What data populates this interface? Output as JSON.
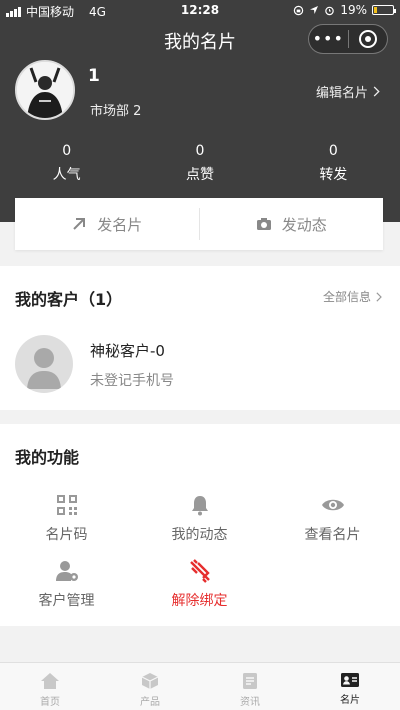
{
  "status_bar": {
    "carrier": "中国移动",
    "network": "4G",
    "time": "12:28",
    "battery": "19%",
    "battery_level": 0.19
  },
  "nav": {
    "title": "我的名片",
    "more": "•••"
  },
  "profile": {
    "name": "1",
    "department": "市场部 2",
    "edit_label": "编辑名片"
  },
  "stats": [
    {
      "value": "0",
      "label": "人气"
    },
    {
      "value": "0",
      "label": "点赞"
    },
    {
      "value": "0",
      "label": "转发"
    }
  ],
  "actions": {
    "send_card": "发名片",
    "post_moment": "发动态"
  },
  "customers": {
    "title": "我的客户（1）",
    "all_info": "全部信息",
    "items": [
      {
        "name": "神秘客户-0",
        "phone": "未登记手机号"
      }
    ]
  },
  "functions": {
    "title": "我的功能",
    "items": [
      {
        "label": "名片码",
        "icon": "qr-code-icon"
      },
      {
        "label": "我的动态",
        "icon": "bell-icon"
      },
      {
        "label": "查看名片",
        "icon": "eye-icon"
      },
      {
        "label": "客户管理",
        "icon": "user-settings-icon"
      },
      {
        "label": "解除绑定",
        "icon": "unlink-icon",
        "color": "#e62e2e"
      }
    ]
  },
  "tabbar": {
    "items": [
      {
        "label": "首页",
        "icon": "home-icon"
      },
      {
        "label": "产品",
        "icon": "box-icon"
      },
      {
        "label": "资讯",
        "icon": "news-icon"
      },
      {
        "label": "名片",
        "icon": "card-icon",
        "active": true
      }
    ]
  }
}
